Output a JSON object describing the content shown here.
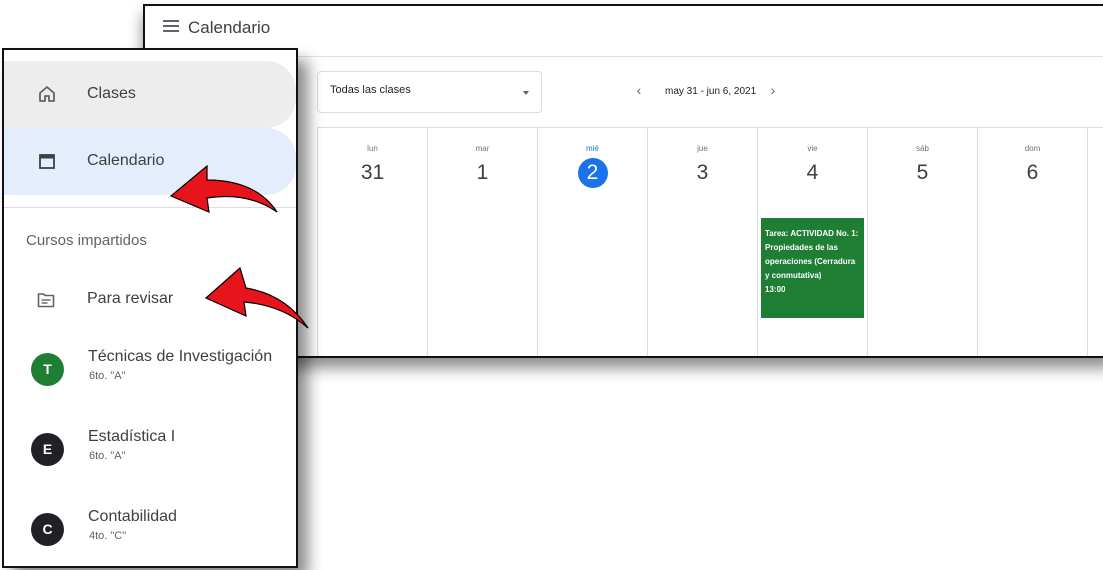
{
  "calendar_window": {
    "title": "Calendario",
    "class_filter": "Todas las clases",
    "date_range": "may 31 - jun 6, 2021",
    "days": [
      {
        "name": "lun",
        "num": "31"
      },
      {
        "name": "mar",
        "num": "1"
      },
      {
        "name": "mié",
        "num": "2"
      },
      {
        "name": "jue",
        "num": "3"
      },
      {
        "name": "vie",
        "num": "4"
      },
      {
        "name": "sáb",
        "num": "5"
      },
      {
        "name": "dom",
        "num": "6"
      }
    ],
    "event": {
      "text": "Tarea: ACTIVIDAD No. 1: Propiedades de las operaciones (Cerradura y conmutativa)",
      "time": "13:00",
      "color": "#1e7e34"
    },
    "today_color": "#1a73e8"
  },
  "sidebar": {
    "clases_label": "Clases",
    "calendario_label": "Calendario",
    "section_title": "Cursos impartidos",
    "review_label": "Para revisar",
    "courses": [
      {
        "initial": "T",
        "name": "Técnicas de Investigación",
        "section": "6to. \"A\"",
        "color": "#1e7e34"
      },
      {
        "initial": "E",
        "name": "Estadística I",
        "section": "6to. \"A\"",
        "color": "#202124"
      },
      {
        "initial": "C",
        "name": "Contabilidad",
        "section": "4to. \"C\"",
        "color": "#202124"
      }
    ]
  },
  "annotation_color": "#e8141b"
}
